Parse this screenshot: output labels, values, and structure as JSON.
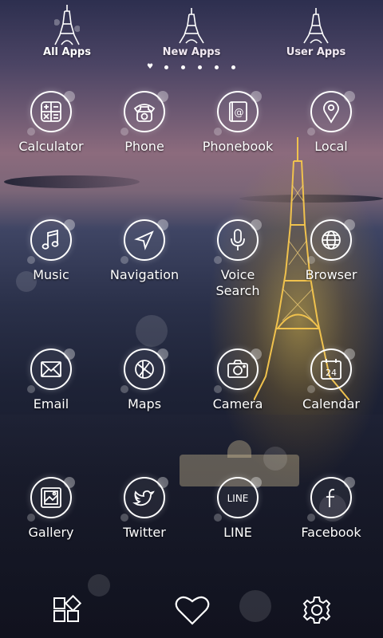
{
  "tabs": [
    {
      "label": "All Apps",
      "active": true
    },
    {
      "label": "New Apps",
      "active": false
    },
    {
      "label": "User Apps",
      "active": false
    }
  ],
  "page_indicator": {
    "count": 6,
    "current": 1
  },
  "apps": [
    {
      "label": "Calculator",
      "icon": "calculator-icon"
    },
    {
      "label": "Phone",
      "icon": "phone-icon"
    },
    {
      "label": "Phonebook",
      "icon": "phonebook-icon"
    },
    {
      "label": "Local",
      "icon": "location-pin-icon"
    },
    {
      "label": "Music",
      "icon": "music-note-icon"
    },
    {
      "label": "Navigation",
      "icon": "navigation-arrow-icon"
    },
    {
      "label": "Voice\nSearch",
      "icon": "microphone-icon"
    },
    {
      "label": "Browser",
      "icon": "globe-icon"
    },
    {
      "label": "Email",
      "icon": "envelope-icon"
    },
    {
      "label": "Maps",
      "icon": "map-icon"
    },
    {
      "label": "Camera",
      "icon": "camera-icon"
    },
    {
      "label": "Calendar",
      "icon": "calendar-icon"
    },
    {
      "label": "Gallery",
      "icon": "picture-icon"
    },
    {
      "label": "Twitter",
      "icon": "twitter-bird-icon"
    },
    {
      "label": "LINE",
      "icon": "line-logo-icon"
    },
    {
      "label": "Facebook",
      "icon": "facebook-f-icon"
    }
  ],
  "calendar_day": "24",
  "line_text": "LINE",
  "dock": [
    {
      "icon": "widgets-icon"
    },
    {
      "icon": "heart-icon"
    },
    {
      "icon": "gear-icon"
    }
  ],
  "colors": {
    "icon_stroke": "#ffffff",
    "tower_gold": "#e8b84a"
  }
}
